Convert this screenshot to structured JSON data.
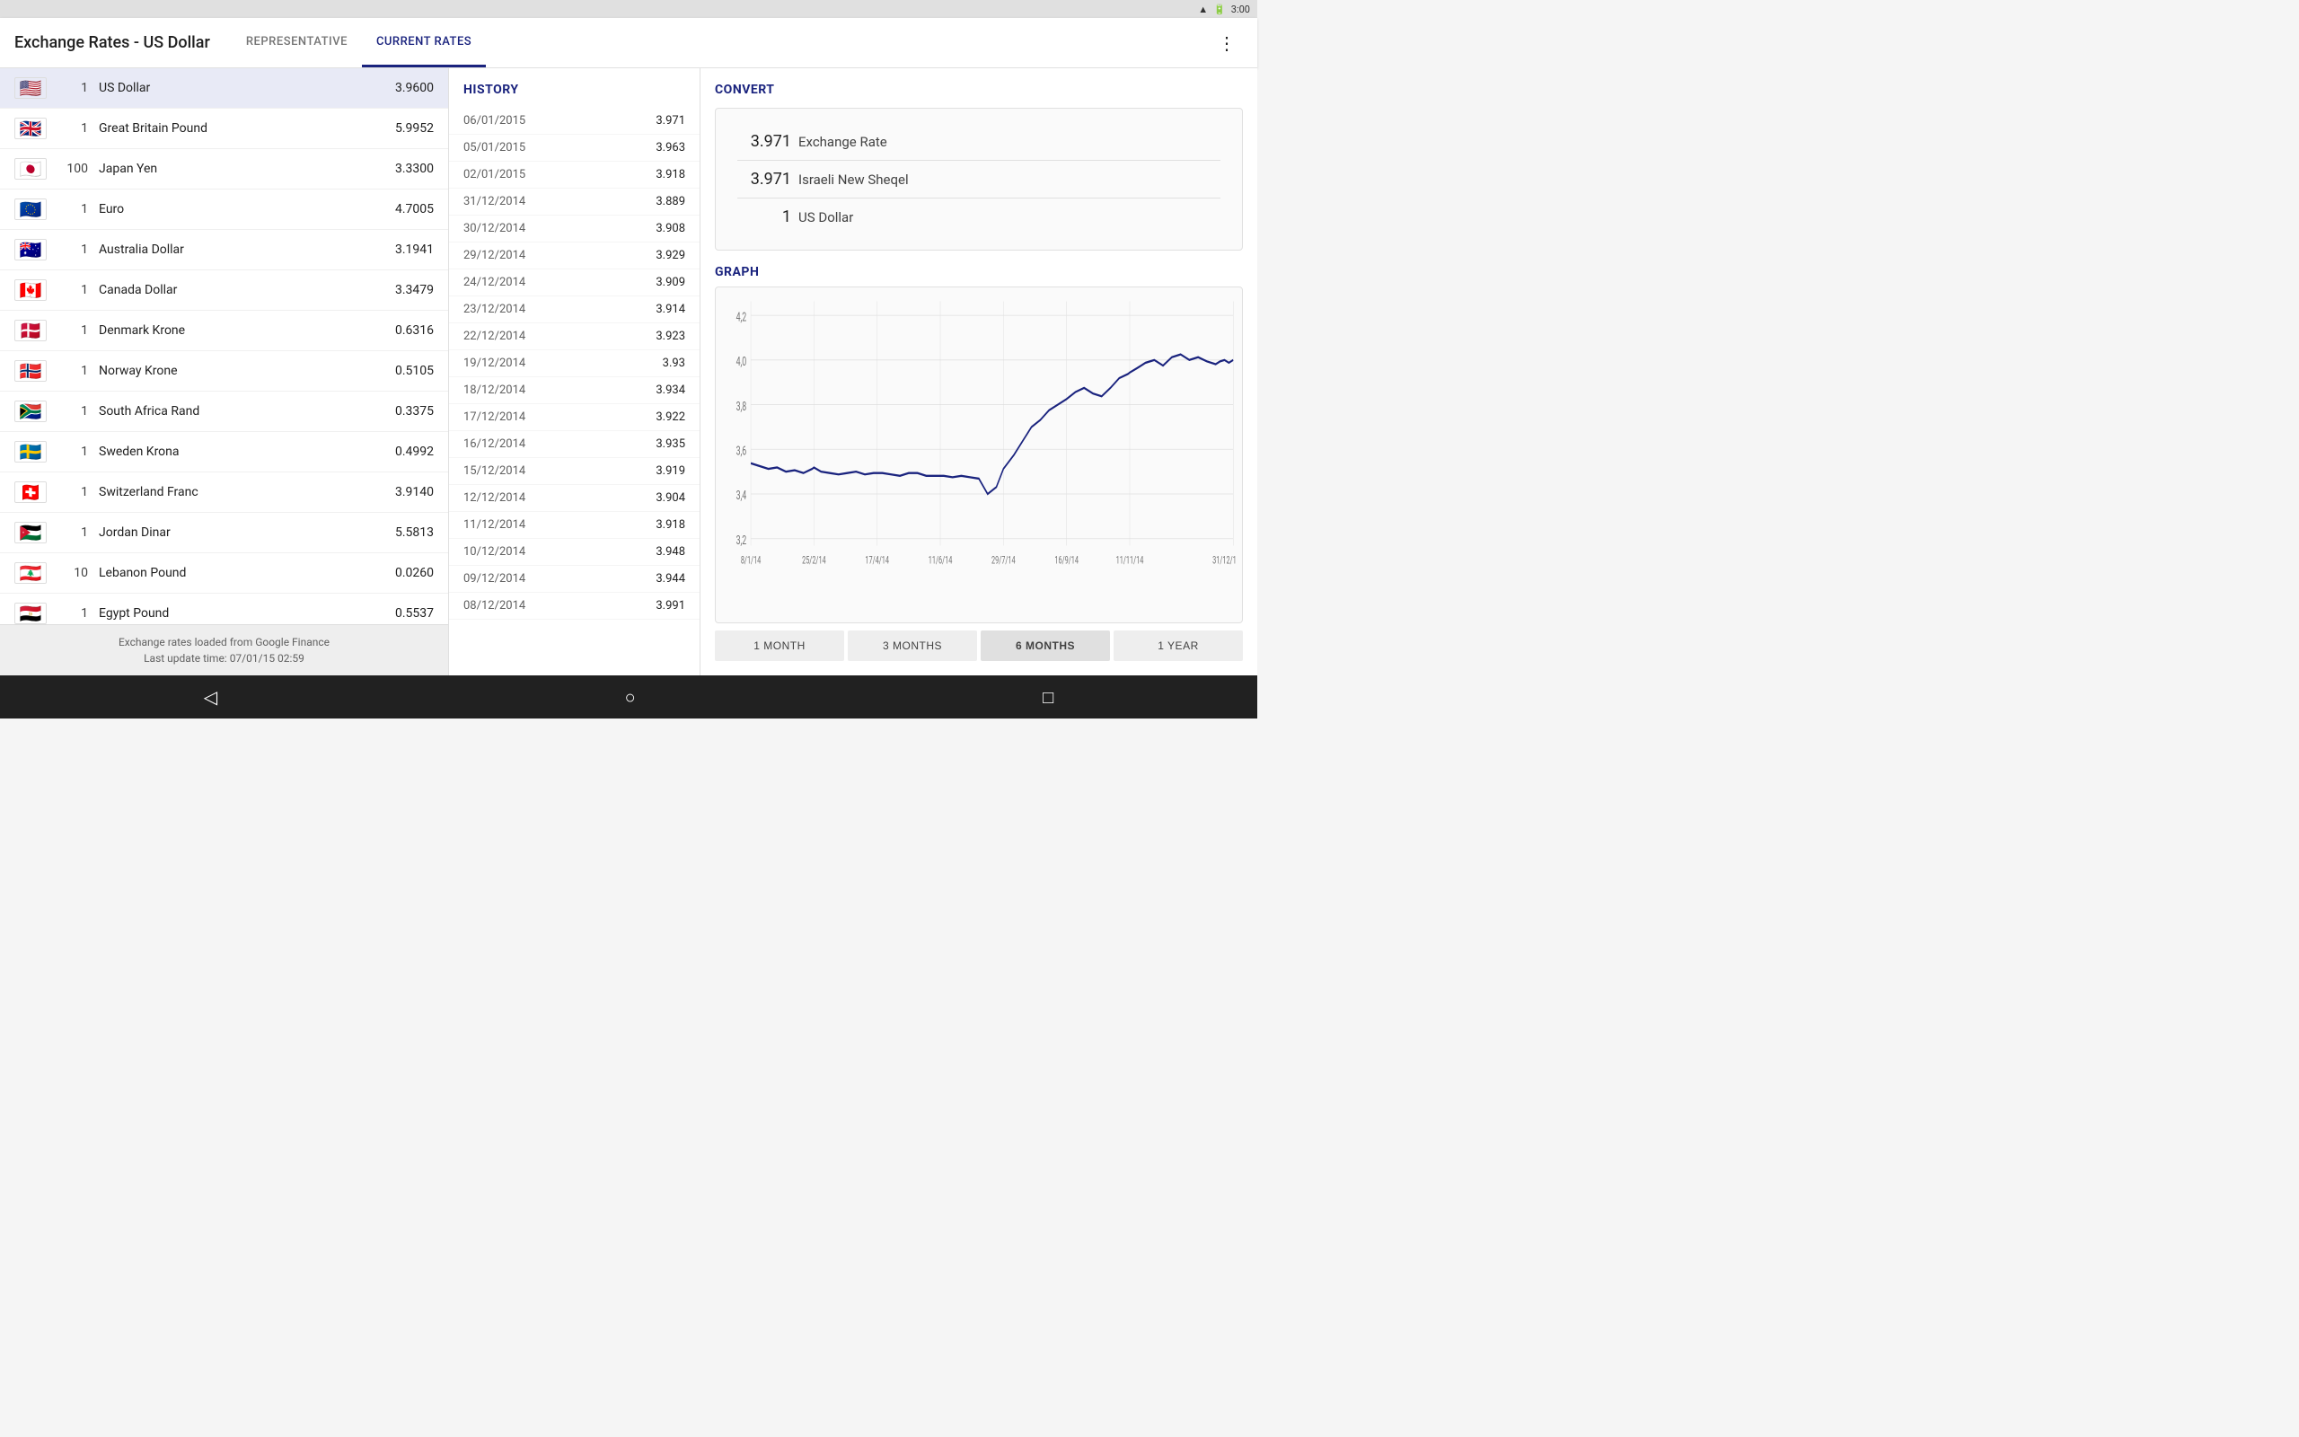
{
  "statusBar": {
    "time": "3:00",
    "wifiIcon": "wifi",
    "batteryIcon": "battery"
  },
  "appBar": {
    "title": "Exchange Rates - US Dollar",
    "tabs": [
      {
        "id": "representative",
        "label": "REPRESENTATIVE",
        "active": false
      },
      {
        "id": "current-rates",
        "label": "CURRENT RATES",
        "active": true
      }
    ],
    "menuIcon": "⋮"
  },
  "rates": [
    {
      "flag": "🇺🇸",
      "flagClass": "flag-us",
      "qty": "1",
      "name": "US Dollar",
      "value": "3.9600",
      "selected": true
    },
    {
      "flag": "🇬🇧",
      "flagClass": "flag-gb",
      "qty": "1",
      "name": "Great Britain Pound",
      "value": "5.9952",
      "selected": false
    },
    {
      "flag": "🇯🇵",
      "flagClass": "flag-jp",
      "qty": "100",
      "name": "Japan Yen",
      "value": "3.3300",
      "selected": false
    },
    {
      "flag": "🇪🇺",
      "flagClass": "flag-eu",
      "qty": "1",
      "name": "Euro",
      "value": "4.7005",
      "selected": false
    },
    {
      "flag": "🇦🇺",
      "flagClass": "flag-au",
      "qty": "1",
      "name": "Australia Dollar",
      "value": "3.1941",
      "selected": false
    },
    {
      "flag": "🇨🇦",
      "flagClass": "flag-ca",
      "qty": "1",
      "name": "Canada Dollar",
      "value": "3.3479",
      "selected": false
    },
    {
      "flag": "🇩🇰",
      "flagClass": "flag-dk",
      "qty": "1",
      "name": "Denmark Krone",
      "value": "0.6316",
      "selected": false
    },
    {
      "flag": "🇳🇴",
      "flagClass": "flag-no",
      "qty": "1",
      "name": "Norway Krone",
      "value": "0.5105",
      "selected": false
    },
    {
      "flag": "🇿🇦",
      "flagClass": "flag-za",
      "qty": "1",
      "name": "South Africa Rand",
      "value": "0.3375",
      "selected": false
    },
    {
      "flag": "🇸🇪",
      "flagClass": "flag-se",
      "qty": "1",
      "name": "Sweden Krona",
      "value": "0.4992",
      "selected": false
    },
    {
      "flag": "🇨🇭",
      "flagClass": "flag-ch",
      "qty": "1",
      "name": "Switzerland Franc",
      "value": "3.9140",
      "selected": false
    },
    {
      "flag": "🇯🇴",
      "flagClass": "flag-jo",
      "qty": "1",
      "name": "Jordan Dinar",
      "value": "5.5813",
      "selected": false
    },
    {
      "flag": "🇱🇧",
      "flagClass": "flag-lb",
      "qty": "10",
      "name": "Lebanon Pound",
      "value": "0.0260",
      "selected": false
    },
    {
      "flag": "🇪🇬",
      "flagClass": "flag-eg",
      "qty": "1",
      "name": "Egypt Pound",
      "value": "0.5537",
      "selected": false
    }
  ],
  "footer": {
    "line1": "Exchange rates loaded from Google Finance",
    "line2": "Last update time: 07/01/15 02:59"
  },
  "history": {
    "title": "HISTORY",
    "rows": [
      {
        "date": "06/01/2015",
        "value": "3.971"
      },
      {
        "date": "05/01/2015",
        "value": "3.963"
      },
      {
        "date": "02/01/2015",
        "value": "3.918"
      },
      {
        "date": "31/12/2014",
        "value": "3.889"
      },
      {
        "date": "30/12/2014",
        "value": "3.908"
      },
      {
        "date": "29/12/2014",
        "value": "3.929"
      },
      {
        "date": "24/12/2014",
        "value": "3.909"
      },
      {
        "date": "23/12/2014",
        "value": "3.914"
      },
      {
        "date": "22/12/2014",
        "value": "3.923"
      },
      {
        "date": "19/12/2014",
        "value": "3.93"
      },
      {
        "date": "18/12/2014",
        "value": "3.934"
      },
      {
        "date": "17/12/2014",
        "value": "3.922"
      },
      {
        "date": "16/12/2014",
        "value": "3.935"
      },
      {
        "date": "15/12/2014",
        "value": "3.919"
      },
      {
        "date": "12/12/2014",
        "value": "3.904"
      },
      {
        "date": "11/12/2014",
        "value": "3.918"
      },
      {
        "date": "10/12/2014",
        "value": "3.948"
      },
      {
        "date": "09/12/2014",
        "value": "3.944"
      },
      {
        "date": "08/12/2014",
        "value": "3.991"
      }
    ]
  },
  "convert": {
    "title": "CONVERT",
    "exchangeRate": "3.971",
    "exchangeRateLabel": "Exchange Rate",
    "sheqelAmount": "3.971",
    "sheqelLabel": "Israeli New Sheqel",
    "dollarAmount": "1",
    "dollarLabel": "US Dollar"
  },
  "graph": {
    "title": "GRAPH",
    "xLabels": [
      "8/1/14",
      "25/2/14",
      "17/4/14",
      "11/6/14",
      "29/7/14",
      "16/9/14",
      "11/11/14",
      "31/12/1"
    ],
    "yLabels": [
      "4,2",
      "4,0",
      "3,8",
      "3,6",
      "3,4",
      "3,2"
    ],
    "buttons": [
      {
        "label": "1 MONTH",
        "active": false
      },
      {
        "label": "3 MONTHS",
        "active": false
      },
      {
        "label": "6 MONTHS",
        "active": true
      },
      {
        "label": "1 YEAR",
        "active": false
      }
    ]
  },
  "navBar": {
    "backIcon": "◁",
    "homeIcon": "○",
    "recentIcon": "□"
  }
}
